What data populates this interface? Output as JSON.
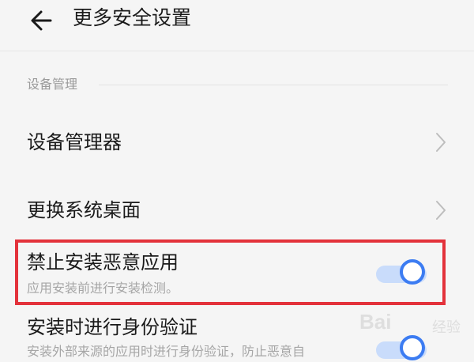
{
  "header": {
    "back_icon": "arrow-left-icon",
    "title": "更多安全设置"
  },
  "section": {
    "label": "设备管理"
  },
  "rows": [
    {
      "title": "设备管理器",
      "icon": "chevron-right-icon"
    },
    {
      "title": "更换系统桌面",
      "icon": "chevron-right-icon"
    },
    {
      "title": "禁止安装恶意应用",
      "subtitle": "应用安装前进行安装检测。",
      "toggle_on": true
    },
    {
      "title": "安装时进行身份验证",
      "subtitle": "安装外部来源的应用时进行身份验证，防止恶意自",
      "toggle_on": true
    }
  ],
  "watermark": {
    "text": "Bai",
    "subtext": "经验"
  },
  "colors": {
    "accent": "#3c7cf2",
    "highlight": "#e3323b",
    "background": "#f5f5f5"
  }
}
